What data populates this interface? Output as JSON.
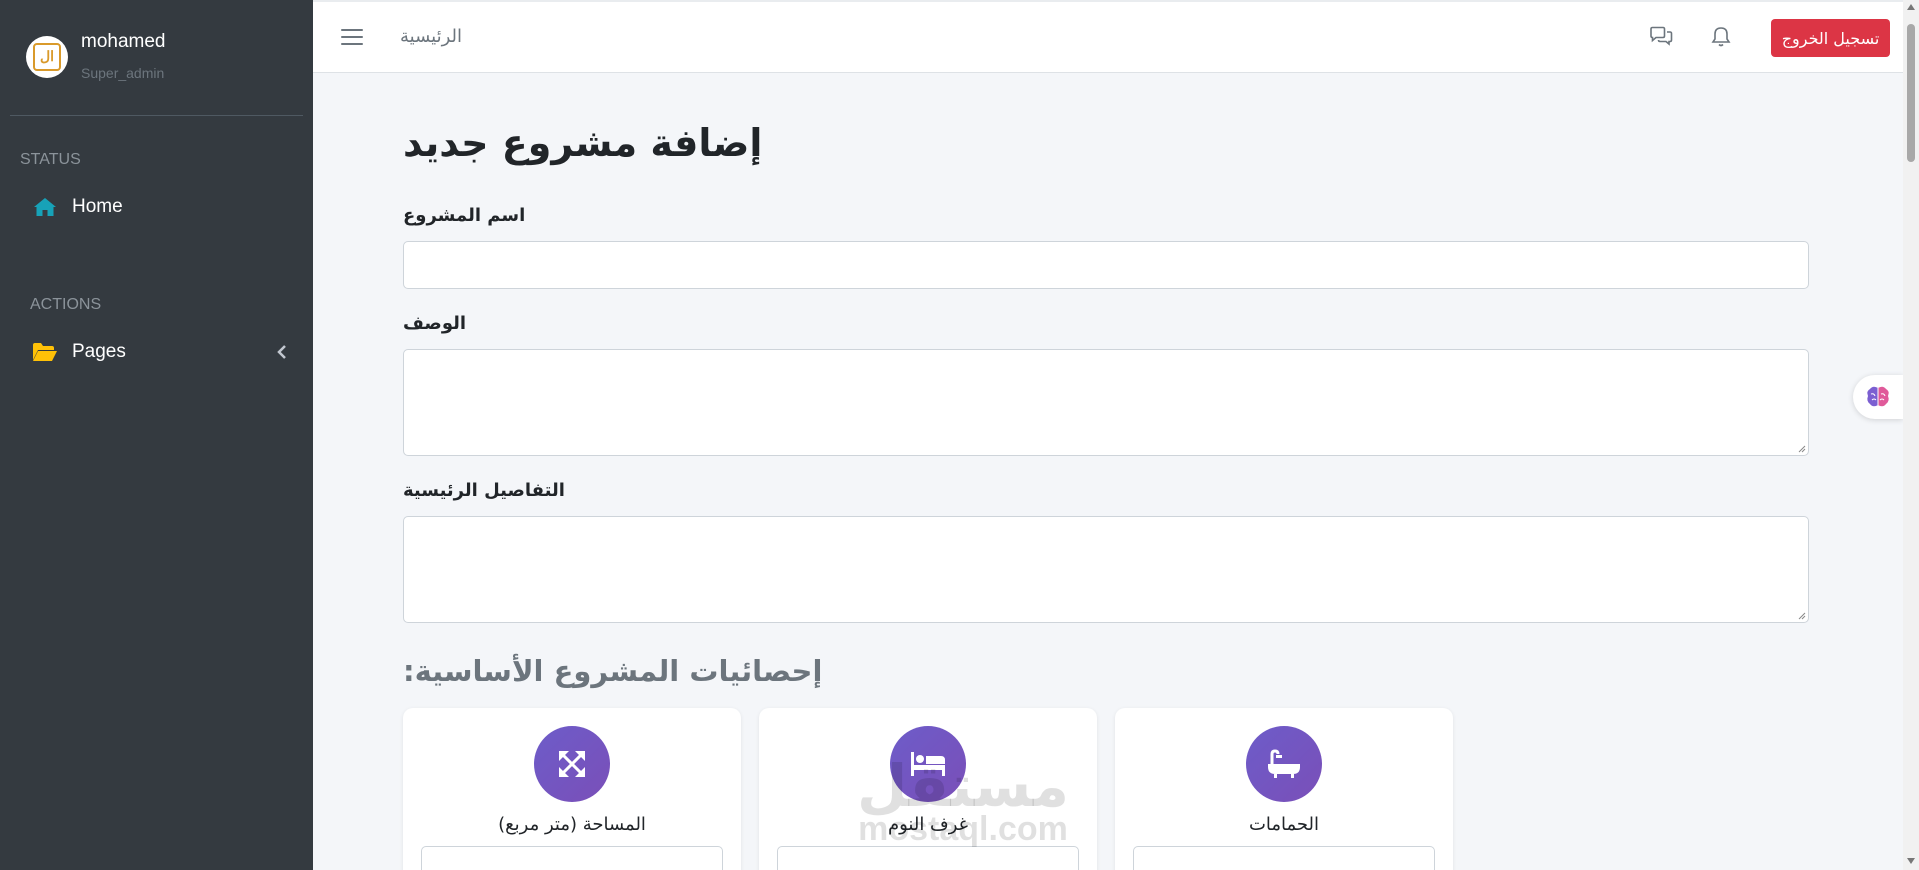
{
  "sidebar": {
    "user": {
      "name": "mohamed",
      "role": "Super_admin",
      "avatar_text": "ال"
    },
    "sections": [
      {
        "header": "STATUS",
        "items": [
          {
            "label": "Home",
            "icon": "home-icon"
          }
        ]
      },
      {
        "header": "ACTIONS",
        "items": [
          {
            "label": "Pages",
            "icon": "folder-open-icon"
          }
        ]
      }
    ]
  },
  "topbar": {
    "breadcrumb_home": "الرئيسية",
    "logout_label": "تسجيل الخروج",
    "icons": [
      "menu-icon",
      "chat-icon",
      "bell-icon"
    ]
  },
  "form": {
    "title": "إضافة مشروع جديد",
    "fields": [
      {
        "label": "اسم المشروع",
        "value": ""
      },
      {
        "label": "الوصف",
        "value": ""
      },
      {
        "label": "التفاصيل الرئيسية",
        "value": ""
      }
    ],
    "stats_heading": "إحصائيات المشروع الأساسية:",
    "stats": [
      {
        "label": "المساحة (متر مربع)",
        "icon": "expand-arrows-icon"
      },
      {
        "label": "غرف النوم",
        "icon": "bed-icon"
      },
      {
        "label": "الحمامات",
        "icon": "bath-icon"
      }
    ]
  },
  "watermark": {
    "arabic": "مستقل",
    "latin": "mostaql.com"
  },
  "colors": {
    "sidebar_bg": "#343a40",
    "logout_bg": "#dc3545",
    "home_icon": "#17a2b8",
    "folder_icon": "#ffc107",
    "stat_circle": "#6d5cc9"
  }
}
